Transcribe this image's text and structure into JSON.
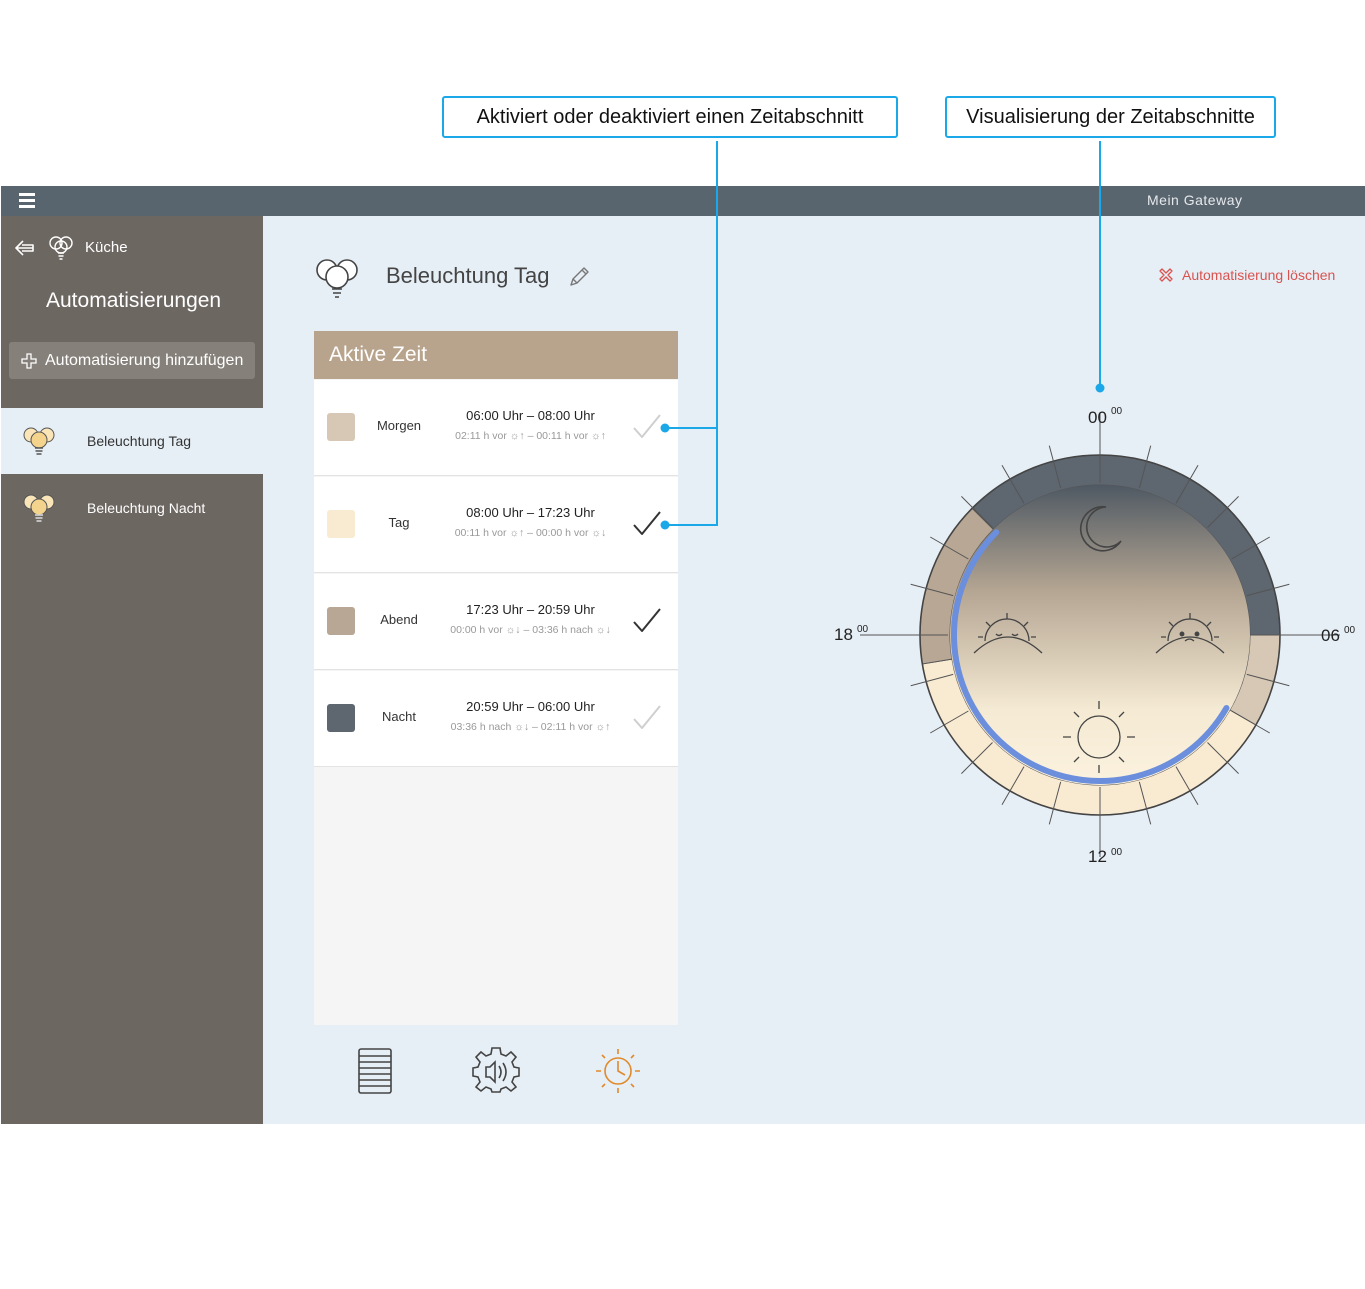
{
  "callouts": {
    "toggle": "Aktiviert oder deaktiviert einen Zeitabschnitt",
    "visual": "Visualisierung der Zeitabschnitte"
  },
  "topbar": {
    "gateway": "Mein Gateway"
  },
  "sidebar": {
    "room": "Küche",
    "heading": "Automatisierungen",
    "add_button": "Automatisierung hinzufügen",
    "items": [
      {
        "label": "Beleuchtung Tag",
        "selected": true
      },
      {
        "label": "Beleuchtung Nacht",
        "selected": false
      }
    ]
  },
  "main": {
    "title": "Beleuchtung Tag",
    "delete": "Automatisierung löschen",
    "card_header": "Aktive Zeit",
    "periods": [
      {
        "name": "Morgen",
        "color": "#d6c8b4",
        "time": "06:00 Uhr – 08:00 Uhr",
        "sub": "02:11 h vor ☼↑ – 00:11 h vor ☼↑",
        "active": false
      },
      {
        "name": "Tag",
        "color": "#f9ead2",
        "time": "08:00 Uhr – 17:23 Uhr",
        "sub": "00:11 h vor ☼↑ – 00:00 h vor ☼↓",
        "active": true
      },
      {
        "name": "Abend",
        "color": "#b8a794",
        "time": "17:23 Uhr – 20:59 Uhr",
        "sub": "00:00 h vor ☼↓ – 03:36 h nach ☼↓",
        "active": true
      },
      {
        "name": "Nacht",
        "color": "#5e6670",
        "time": "20:59 Uhr – 06:00 Uhr",
        "sub": "03:36 h nach ☼↓ – 02:11 h vor ☼↑",
        "active": false
      }
    ],
    "bottom_icons": [
      "list-icon",
      "gear-sound-icon",
      "sun-clock-icon"
    ]
  },
  "clock": {
    "labels": {
      "top": "00",
      "right": "06",
      "bottom": "12",
      "left": "18",
      "sup": "00"
    }
  },
  "colors": {
    "accent": "#1ba8e8",
    "delete": "#d9534f",
    "arc": "#6b8fdc",
    "orange": "#e08a2c"
  }
}
